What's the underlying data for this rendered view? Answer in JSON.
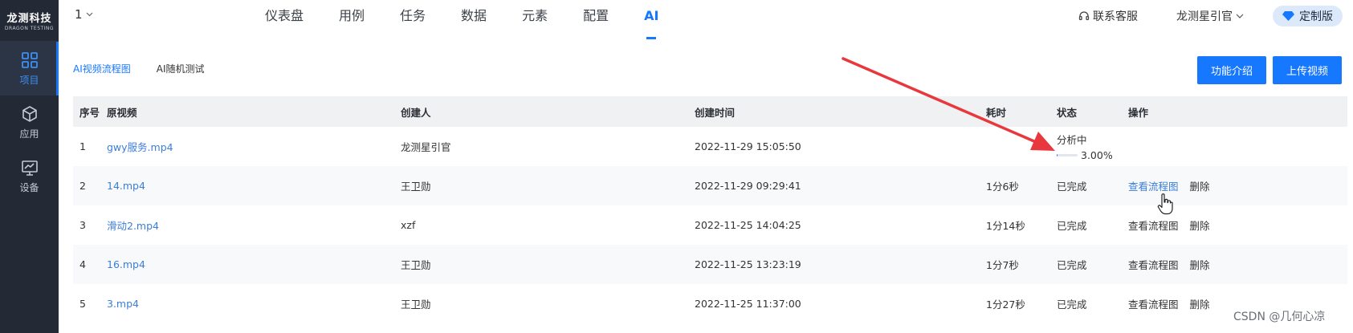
{
  "brand": {
    "logo_main": "龙测科技",
    "logo_sub": "DRAGON TESTING"
  },
  "sidebar": {
    "items": [
      {
        "label": "项目",
        "icon": "grid-icon",
        "active": true
      },
      {
        "label": "应用",
        "icon": "cube-icon",
        "active": false
      },
      {
        "label": "设备",
        "icon": "monitor-icon",
        "active": false
      }
    ]
  },
  "header": {
    "project_select": "1",
    "nav": [
      {
        "label": "仪表盘",
        "active": false
      },
      {
        "label": "用例",
        "active": false
      },
      {
        "label": "任务",
        "active": false
      },
      {
        "label": "数据",
        "active": false
      },
      {
        "label": "元素",
        "active": false
      },
      {
        "label": "配置",
        "active": false
      },
      {
        "label": "AI",
        "active": true
      }
    ],
    "service": "联系客服",
    "user": "龙测星引官",
    "edition": "定制版"
  },
  "page": {
    "tabs": [
      {
        "label": "AI视频流程图",
        "active": true
      },
      {
        "label": "AI随机测试",
        "active": false
      }
    ],
    "buttons": {
      "intro": "功能介绍",
      "upload": "上传视频"
    }
  },
  "table": {
    "headers": [
      "序号",
      "原视频",
      "创建人",
      "创建时间",
      "耗时",
      "状态",
      "操作"
    ],
    "rows": [
      {
        "no": "1",
        "video": "gwy服务.mp4",
        "creator": "龙测星引官",
        "time": "2022-11-29 15:05:50",
        "duration": "",
        "status": "分析中",
        "progress_text": "3.00%",
        "progress": 0.03,
        "view": "",
        "delete": ""
      },
      {
        "no": "2",
        "video": "14.mp4",
        "creator": "王卫勋",
        "time": "2022-11-29 09:29:41",
        "duration": "1分6秒",
        "status": "已完成",
        "view": "查看流程图",
        "delete": "删除",
        "hover": true
      },
      {
        "no": "3",
        "video": "滑动2.mp4",
        "creator": "xzf",
        "time": "2022-11-25 14:04:25",
        "duration": "1分14秒",
        "status": "已完成",
        "view": "查看流程图",
        "delete": "删除"
      },
      {
        "no": "4",
        "video": "16.mp4",
        "creator": "王卫勋",
        "time": "2022-11-25 13:23:19",
        "duration": "1分7秒",
        "status": "已完成",
        "view": "查看流程图",
        "delete": "删除"
      },
      {
        "no": "5",
        "video": "3.mp4",
        "creator": "王卫勋",
        "time": "2022-11-25 11:37:00",
        "duration": "1分27秒",
        "status": "已完成",
        "view": "查看流程图",
        "delete": "删除"
      }
    ]
  },
  "colors": {
    "accent": "#1677ff",
    "sidebar_bg": "#232a36",
    "annotation_arrow": "#e8383d"
  },
  "watermark": "CSDN @几何心凉"
}
